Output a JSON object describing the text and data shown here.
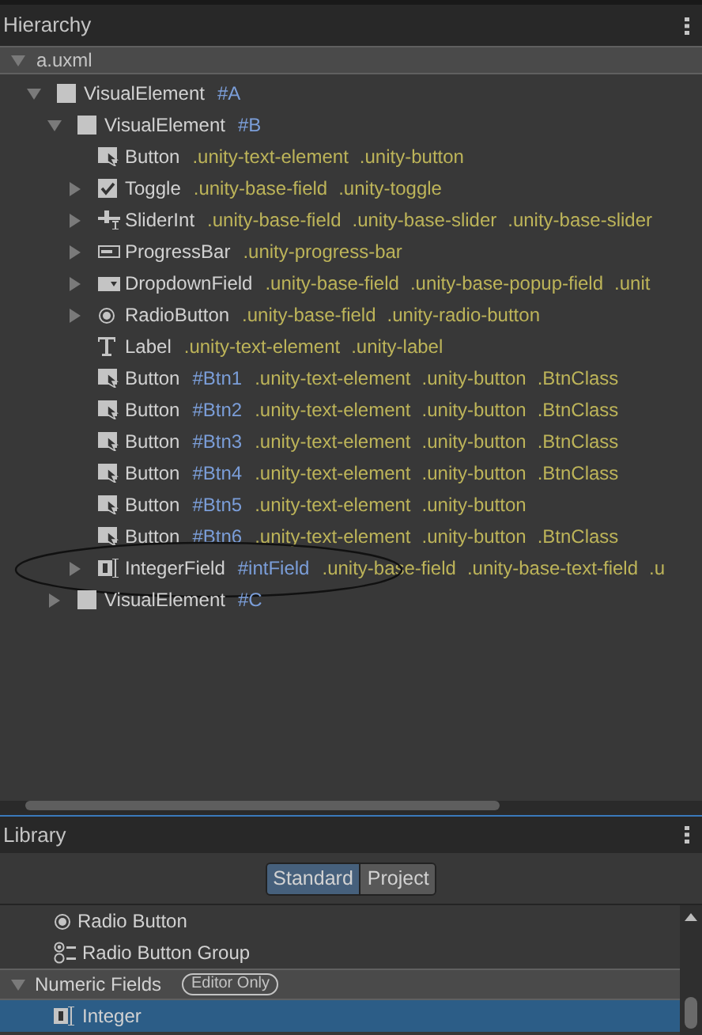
{
  "hierarchy": {
    "title": "Hierarchy",
    "root": {
      "label": "a.uxml",
      "expanded": true,
      "children": [
        {
          "type": "VisualElement",
          "kind": "box",
          "id": "#A",
          "expanded": true,
          "children": [
            {
              "type": "VisualElement",
              "kind": "box",
              "id": "#B",
              "expanded": true,
              "children": [
                {
                  "type": "Button",
                  "kind": "button",
                  "classes": [
                    ".unity-text-element",
                    ".unity-button"
                  ]
                },
                {
                  "type": "Toggle",
                  "kind": "toggle",
                  "expanded": false,
                  "classes": [
                    ".unity-base-field",
                    ".unity-toggle"
                  ]
                },
                {
                  "type": "SliderInt",
                  "kind": "slider",
                  "expanded": false,
                  "classes": [
                    ".unity-base-field",
                    ".unity-base-slider",
                    ".unity-base-slider"
                  ]
                },
                {
                  "type": "ProgressBar",
                  "kind": "progress",
                  "expanded": false,
                  "classes": [
                    ".unity-progress-bar"
                  ]
                },
                {
                  "type": "DropdownField",
                  "kind": "dropdown",
                  "expanded": false,
                  "classes": [
                    ".unity-base-field",
                    ".unity-base-popup-field",
                    ".unit"
                  ]
                },
                {
                  "type": "RadioButton",
                  "kind": "radio",
                  "expanded": false,
                  "classes": [
                    ".unity-base-field",
                    ".unity-radio-button"
                  ]
                },
                {
                  "type": "Label",
                  "kind": "label",
                  "classes": [
                    ".unity-text-element",
                    ".unity-label"
                  ]
                },
                {
                  "type": "Button",
                  "kind": "button",
                  "id": "#Btn1",
                  "classes": [
                    ".unity-text-element",
                    ".unity-button",
                    ".BtnClass"
                  ]
                },
                {
                  "type": "Button",
                  "kind": "button",
                  "id": "#Btn2",
                  "classes": [
                    ".unity-text-element",
                    ".unity-button",
                    ".BtnClass"
                  ]
                },
                {
                  "type": "Button",
                  "kind": "button",
                  "id": "#Btn3",
                  "classes": [
                    ".unity-text-element",
                    ".unity-button",
                    ".BtnClass"
                  ]
                },
                {
                  "type": "Button",
                  "kind": "button",
                  "id": "#Btn4",
                  "classes": [
                    ".unity-text-element",
                    ".unity-button",
                    ".BtnClass"
                  ]
                },
                {
                  "type": "Button",
                  "kind": "button",
                  "id": "#Btn5",
                  "classes": [
                    ".unity-text-element",
                    ".unity-button"
                  ]
                },
                {
                  "type": "Button",
                  "kind": "button",
                  "id": "#Btn6",
                  "classes": [
                    ".unity-text-element",
                    ".unity-button",
                    ".BtnClass"
                  ]
                },
                {
                  "type": "IntegerField",
                  "kind": "intfield",
                  "id": "#intField",
                  "expanded": false,
                  "circled": true,
                  "classes": [
                    ".unity-base-field",
                    ".unity-base-text-field",
                    ".u"
                  ]
                }
              ]
            },
            {
              "type": "VisualElement",
              "kind": "box",
              "id": "#C",
              "expanded": false
            }
          ]
        }
      ]
    }
  },
  "library": {
    "title": "Library",
    "tabs": [
      {
        "label": "Standard",
        "selected": true
      },
      {
        "label": "Project",
        "selected": false
      }
    ],
    "items": [
      {
        "kind": "radio",
        "label": "Radio Button",
        "selected": false
      },
      {
        "kind": "radiogroup",
        "label": "Radio Button Group",
        "selected": false
      },
      {
        "kind": "group",
        "label": "Numeric Fields",
        "badge": "Editor Only",
        "expanded": true
      },
      {
        "kind": "intfield",
        "label": "Integer",
        "selected": true
      }
    ]
  }
}
